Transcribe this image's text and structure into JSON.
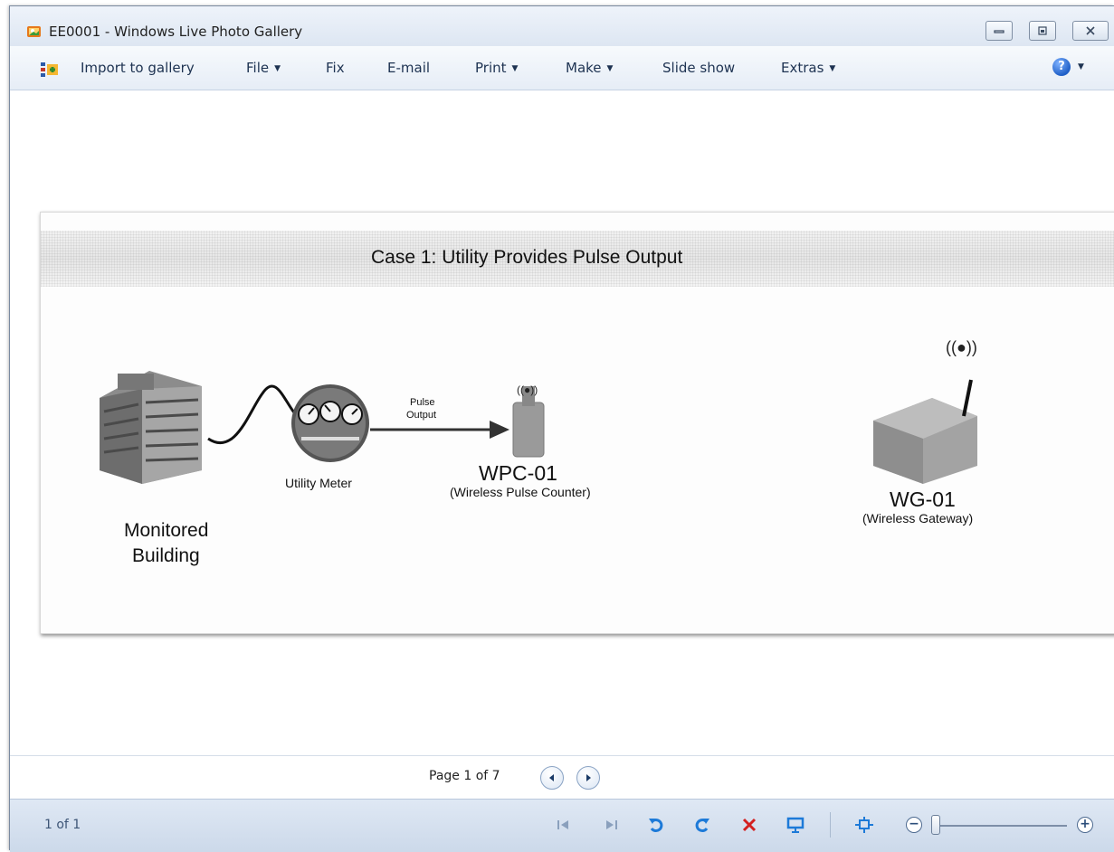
{
  "window": {
    "title": "EE0001 - Windows Live Photo Gallery"
  },
  "menu": {
    "import": "Import to gallery",
    "file": "File",
    "fix": "Fix",
    "email": "E-mail",
    "print": "Print",
    "make": "Make",
    "slideshow": "Slide show",
    "extras": "Extras"
  },
  "photo": {
    "title": "Case 1:  Utility Provides Pulse Output",
    "building_label_1": "Monitored",
    "building_label_2": "Building",
    "meter_label": "Utility Meter",
    "pulse_label_1": "Pulse",
    "pulse_label_2": "Output",
    "wpc_name": "WPC-01",
    "wpc_desc": "(Wireless Pulse Counter)",
    "wg_name": "WG-01",
    "wg_desc": "(Wireless Gateway)"
  },
  "pager": {
    "text": "Page 1 of 7"
  },
  "status": {
    "count": "1 of 1"
  },
  "icons": {
    "app": "photo-gallery-icon",
    "minimize": "minimize-icon",
    "maximize": "maximize-icon",
    "close": "close-icon",
    "help": "help-icon",
    "prev_page": "arrow-left-icon",
    "next_page": "arrow-right-icon",
    "first": "first-icon",
    "last": "last-icon",
    "rotate_left": "rotate-counterclockwise-icon",
    "rotate_right": "rotate-clockwise-icon",
    "delete": "delete-icon",
    "slideshow": "slideshow-icon",
    "fit": "fit-to-window-icon",
    "zoom_out": "zoom-out-icon",
    "zoom_in": "zoom-in-icon"
  },
  "colors": {
    "accent": "#1f5fc7",
    "delete": "#d32020",
    "rotate": "#1d7ad8"
  }
}
